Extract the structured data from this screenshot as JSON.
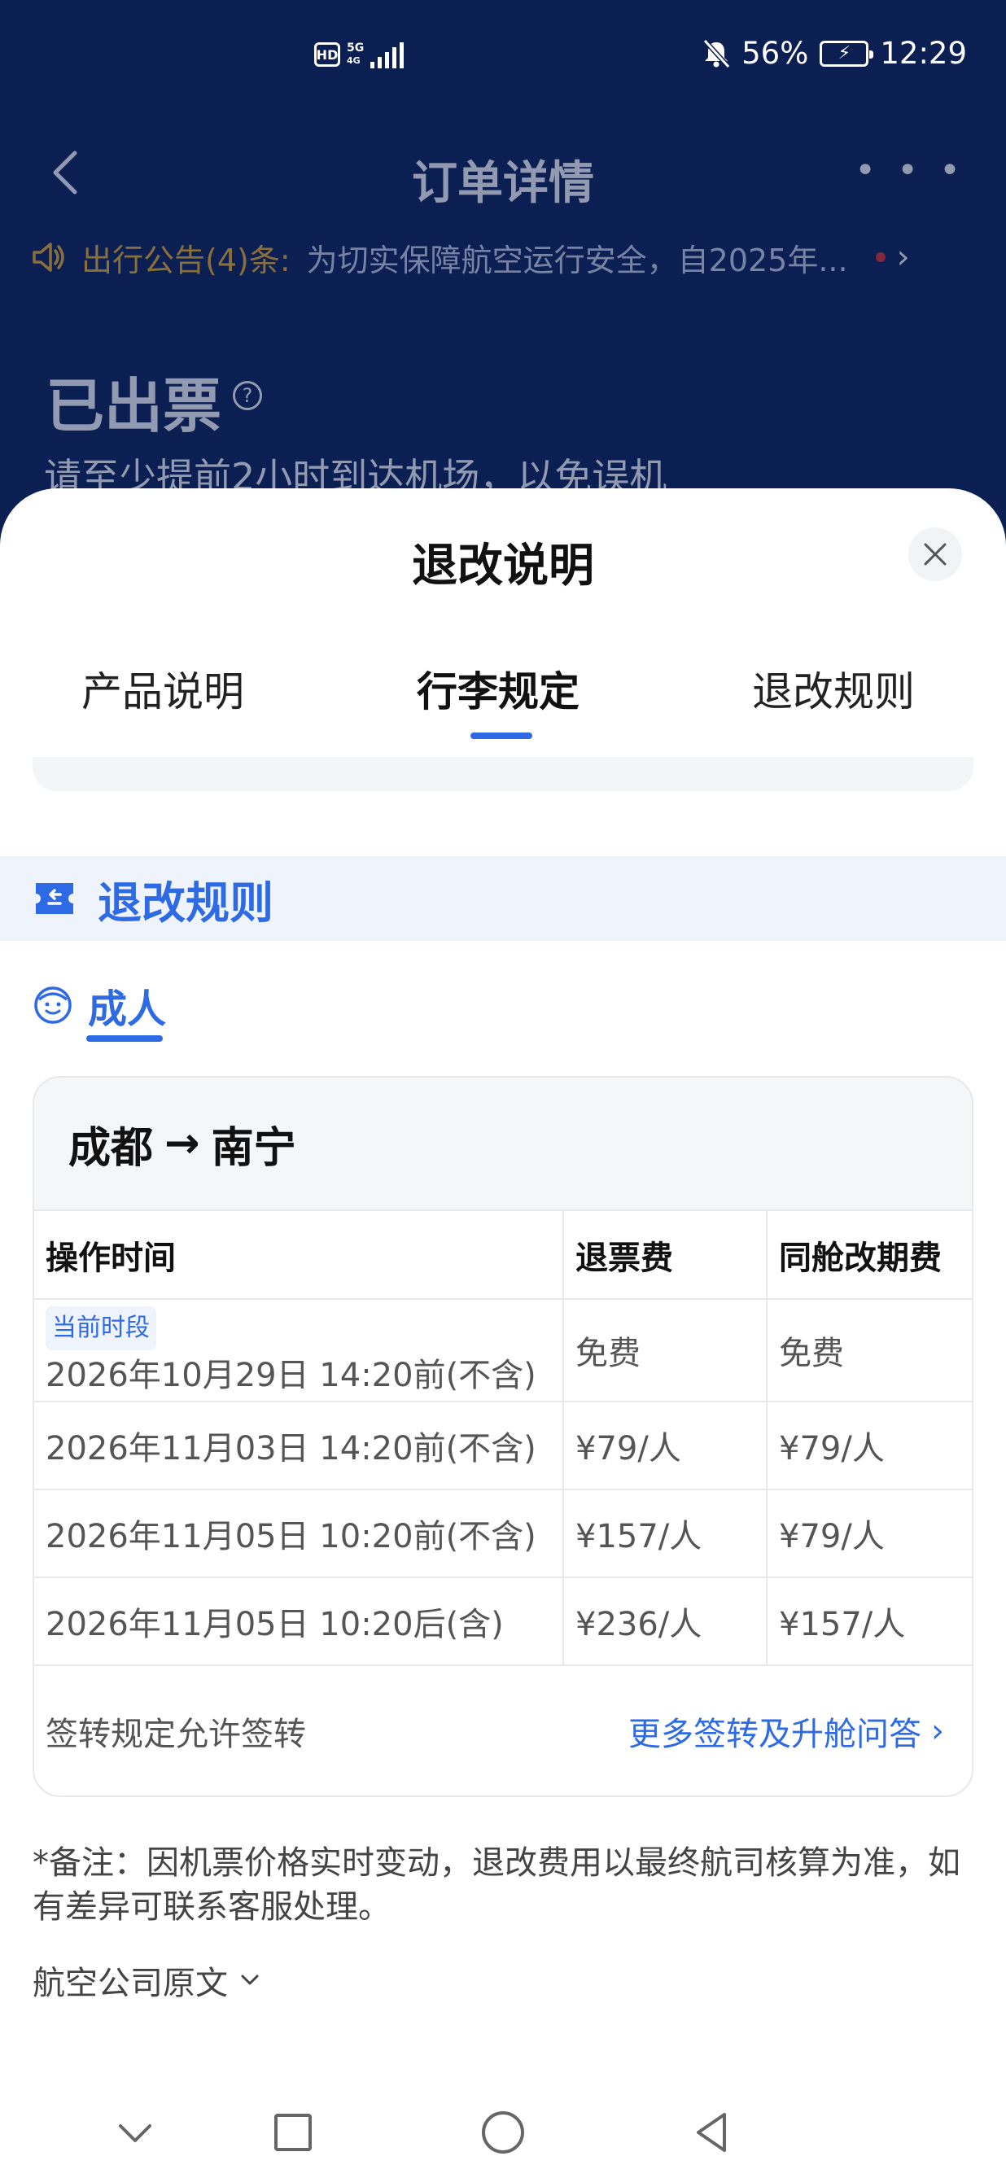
{
  "status_bar": {
    "hd": "HD",
    "network": "5G",
    "network_sub": "4G",
    "battery_percent": "56%",
    "time": "12:29"
  },
  "background_page": {
    "nav_title": "订单详情",
    "more": "• • •",
    "notice_label": "出行公告(4)条:",
    "notice_text": "为切实保障航空运行安全，自2025年...",
    "ticket_status": "已出票",
    "ticket_tip": "请至少提前2小时到达机场，以免误机"
  },
  "sheet": {
    "title": "退改说明",
    "tabs": [
      {
        "label": "产品说明",
        "active": false
      },
      {
        "label": "行李规定",
        "active": true
      },
      {
        "label": "退改规则",
        "active": false
      }
    ],
    "section_title": "退改规则",
    "passenger_type": "成人",
    "route": {
      "from": "成都",
      "arrow": "→",
      "to": "南宁"
    },
    "table": {
      "headers": [
        "操作时间",
        "退票费",
        "同舱改期费"
      ],
      "current_badge": "当前时段",
      "rows": [
        {
          "time": "2026年10月29日 14:20前(不含)",
          "refund": "免费",
          "change": "免费",
          "current": true
        },
        {
          "time": "2026年11月03日 14:20前(不含)",
          "refund": "¥79/人",
          "change": "¥79/人",
          "current": false
        },
        {
          "time": "2026年11月05日 10:20前(不含)",
          "refund": "¥157/人",
          "change": "¥79/人",
          "current": false
        },
        {
          "time": "2026年11月05日 10:20后(含)",
          "refund": "¥236/人",
          "change": "¥157/人",
          "current": false
        }
      ]
    },
    "endorse_rule": "签转规定允许签转",
    "more_link": "更多签转及升舱问答",
    "more_link_chevron": "›",
    "remark": "*备注：因机票价格实时变动，退改费用以最终航司核算为准，如有差异可联系客服处理。",
    "airline_original": "航空公司原文"
  },
  "colors": {
    "accent": "#2f6ae5",
    "header_bg": "#0b1f52",
    "notice_label": "#f0b12b",
    "section_bg": "#eef3fc"
  }
}
